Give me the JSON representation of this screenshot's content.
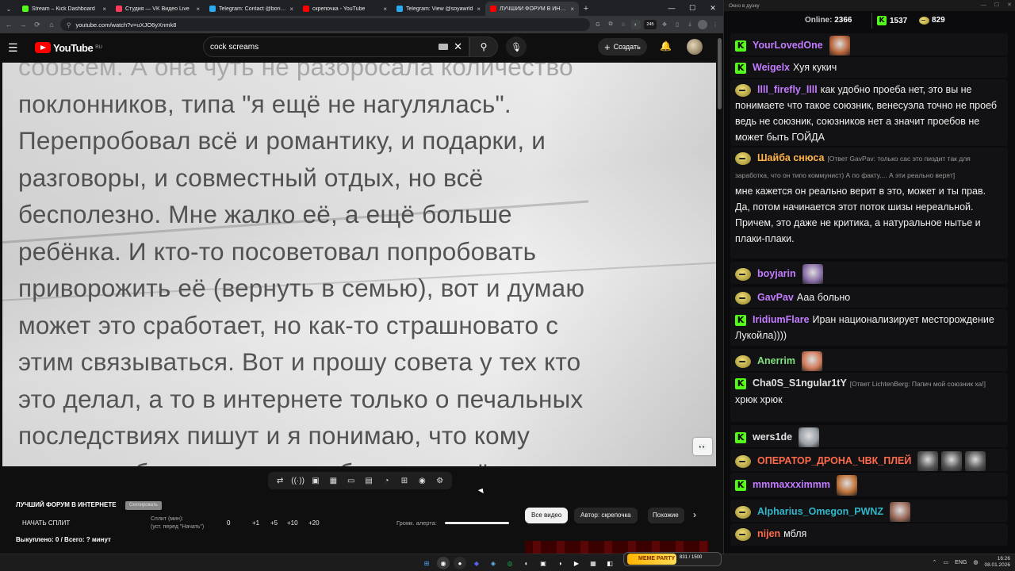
{
  "browser": {
    "tabs": [
      {
        "title": "Stream – Kick Dashboard",
        "color": "#53fc18",
        "active": false
      },
      {
        "title": "Студия — VK Видео Live",
        "color": "#ff3b5c",
        "active": false
      },
      {
        "title": "Telegram: Contact @boris_rock",
        "color": "#2aabee",
        "active": false
      },
      {
        "title": "скрепочка - YouTube",
        "color": "#ff0000",
        "active": false
      },
      {
        "title": "Telegram: View @soyawrld",
        "color": "#2aabee",
        "active": false
      },
      {
        "title": "ЛУЧШИЙ ФОРУМ В ИНТЕРНЕ",
        "color": "#ff0000",
        "active": true
      }
    ],
    "url": "youtube.com/watch?v=uXJO6yXnmk8",
    "ext_badge": "245"
  },
  "youtube": {
    "logo": "YouTube",
    "region": "RU",
    "search_query": "cock screams",
    "create_label": "Создать"
  },
  "video": {
    "lines": [
      {
        "text": "соовсем. А она чуть не разбросала количество",
        "tone": "fd"
      },
      {
        "text": "поклонников, типа \"я ещё не нагулялась\".",
        "tone": "fm"
      },
      {
        "text": "Перепробовал всё и романтику, и подарки, и",
        "tone": "fm"
      },
      {
        "text": "разговоры, и совместный отдых, но всё",
        "tone": "fm"
      },
      {
        "text": "бесполезно. Мне жалко её, а ещё больше",
        "tone": "fm"
      },
      {
        "text": "ребёнка. И кто-то посоветовал попробовать",
        "tone": "fm"
      },
      {
        "text": "приворожить её (вернуть в семью), вот и думаю",
        "tone": "fm"
      },
      {
        "text": "может это сработает, но как-то страшновато с",
        "tone": "fm"
      },
      {
        "text": "этим связываться. Вот и прошу совета у тех кто",
        "tone": "fm"
      },
      {
        "text": "это делал, а то в интернете только о печальных",
        "tone": "fm"
      },
      {
        "text": "последствиях пишут и я понимаю, что кому",
        "tone": "fm"
      },
      {
        "text": "повезло об этом писать не будут, но всё же",
        "tone": "fm"
      }
    ],
    "eyes_label": "👀"
  },
  "panel": {
    "title": "ЛУЧШИЙ ФОРУМ В ИНТЕРНЕТЕ",
    "badge": "Скопировать",
    "start_split": "НАЧАТЬ СПЛИТ",
    "split_label_1": "Сплит (мин):",
    "split_label_2": "(уст. перед \"Начать\")",
    "split_value": "0",
    "increments": [
      "+1",
      "+5",
      "+10",
      "+20"
    ],
    "alert_label": "Громк. алерта:",
    "alert_volume": 1.0,
    "bought": "Выкуплено: 0 / Всего: ? минут"
  },
  "chips": [
    "Все видео",
    "Автор: скрепочка",
    "Похожие"
  ],
  "chat": {
    "window_title": "Окно в дуэку",
    "online_label": "Online:",
    "online": "2366",
    "kick_count": "1537",
    "coin_count": "829",
    "messages": [
      {
        "badge": "kick",
        "name": "YourLovedOne",
        "color": "#c37cff",
        "reply": "",
        "text": "",
        "emote": "#b8643a"
      },
      {
        "badge": "kick",
        "name": "Weigelx",
        "color": "#c37cff",
        "reply": "",
        "text": "Хуя кукич",
        "emote": ""
      },
      {
        "badge": "blob",
        "name": "llll_firefly_llll",
        "color": "#c37cff",
        "reply": "",
        "text": "как удобно проеба нет, это вы не понимаете что такое союзник, венесуэла точно не проеб ведь не союзник, союзников нет а значит проебов не может быть ГОЙДА",
        "emote": ""
      },
      {
        "badge": "blob",
        "name": "Шайба снюса",
        "color": "#ffb347",
        "reply": "[Ответ GavPav: только сас это пиздит так для заработка, что он типо коммунист) А по факту.... А эти реально верят]",
        "text": "мне кажется он реально верит в это, может и ты прав. Да, потом начинается этот поток шизы нереальной. Причем, это даже не критика, а натуральное нытье и плаки-плаки.",
        "emote": ""
      },
      {
        "badge": "blob",
        "name": "boyjarin",
        "color": "#c37cff",
        "reply": "",
        "text": "",
        "emote": "#8a6fa8"
      },
      {
        "badge": "blob",
        "name": "GavPav",
        "color": "#c37cff",
        "reply": "",
        "text": "Ааа больно",
        "emote": ""
      },
      {
        "badge": "kick",
        "name": "IridiumFlare",
        "color": "#c37cff",
        "reply": "",
        "text": "Иран национализирует месторождение Лукойла))))",
        "emote": ""
      },
      {
        "badge": "blob",
        "name": "Anerrim",
        "color": "#7ee37e",
        "reply": "",
        "text": "",
        "emote": "#d07a5a"
      },
      {
        "badge": "kick",
        "name": "Cha0S_S1ngular1tY",
        "color": "#e0e0e0",
        "reply": "[Ответ LichtenBerg: Папич мой союзник ха!]",
        "text": "хрюк хрюк",
        "emote": ""
      },
      {
        "badge": "kick",
        "name": "wers1de",
        "color": "#e0e0e0",
        "reply": "",
        "text": "",
        "emote": "#9aa0a6"
      },
      {
        "badge": "blob",
        "name": "ОПЕРАТОР_ДРОНА_ЧВК_ПЛЕЙ",
        "color": "#ff6b4a",
        "reply": "",
        "text": "",
        "emote": "#555555"
      },
      {
        "badge": "kick",
        "name": "mmmaxxximmm",
        "color": "#c37cff",
        "reply": "",
        "text": "",
        "emote": "#c0743a"
      },
      {
        "badge": "blob",
        "name": "Alpharius_Omegon_PWNZ",
        "color": "#2fb6c9",
        "reply": "",
        "text": "",
        "emote": "#9a6a5a"
      },
      {
        "badge": "blob",
        "name": "nijen",
        "color": "#ff6b4a",
        "reply": "",
        "text": "мбля",
        "emote": ""
      }
    ]
  },
  "taskbar": {
    "lang": "ENG",
    "time": "16:26",
    "date": "08.01.2026",
    "meme_label": "MEME PARTY",
    "meme_count": "831 / 1500"
  }
}
